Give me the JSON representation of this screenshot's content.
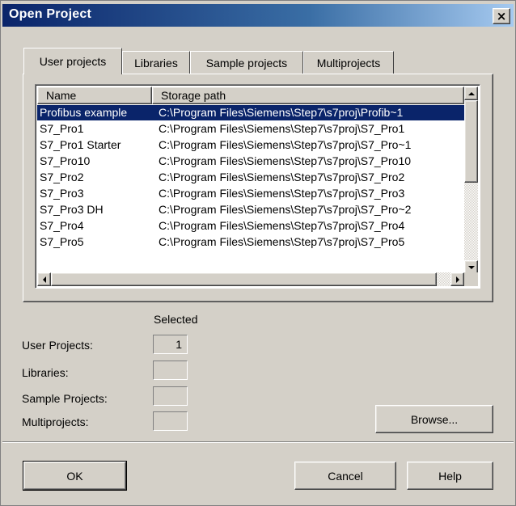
{
  "window": {
    "title": "Open Project",
    "close_glyph": "×"
  },
  "tabs": [
    {
      "label": "User projects",
      "active": true
    },
    {
      "label": "Libraries",
      "active": false
    },
    {
      "label": "Sample projects",
      "active": false
    },
    {
      "label": "Multiprojects",
      "active": false
    }
  ],
  "list": {
    "columns": [
      "Name",
      "Storage path"
    ],
    "rows": [
      {
        "name": "Profibus example",
        "path": "C:\\Program Files\\Siemens\\Step7\\s7proj\\Profib~1",
        "selected": true
      },
      {
        "name": "S7_Pro1",
        "path": "C:\\Program Files\\Siemens\\Step7\\s7proj\\S7_Pro1"
      },
      {
        "name": "S7_Pro1 Starter",
        "path": "C:\\Program Files\\Siemens\\Step7\\s7proj\\S7_Pro~1"
      },
      {
        "name": "S7_Pro10",
        "path": "C:\\Program Files\\Siemens\\Step7\\s7proj\\S7_Pro10"
      },
      {
        "name": "S7_Pro2",
        "path": "C:\\Program Files\\Siemens\\Step7\\s7proj\\S7_Pro2"
      },
      {
        "name": "S7_Pro3",
        "path": "C:\\Program Files\\Siemens\\Step7\\s7proj\\S7_Pro3"
      },
      {
        "name": "S7_Pro3 DH",
        "path": "C:\\Program Files\\Siemens\\Step7\\s7proj\\S7_Pro~2"
      },
      {
        "name": "S7_Pro4",
        "path": "C:\\Program Files\\Siemens\\Step7\\s7proj\\S7_Pro4"
      },
      {
        "name": "S7_Pro5",
        "path": "C:\\Program Files\\Siemens\\Step7\\s7proj\\S7_Pro5"
      }
    ]
  },
  "summary": {
    "header": "Selected",
    "items": [
      {
        "label": "User Projects:",
        "value": "1"
      },
      {
        "label": "Libraries:",
        "value": ""
      },
      {
        "label": "Sample Projects:",
        "value": ""
      },
      {
        "label": "Multiprojects:",
        "value": ""
      }
    ]
  },
  "buttons": {
    "browse": "Browse...",
    "ok": "OK",
    "cancel": "Cancel",
    "help": "Help"
  },
  "colors": {
    "title_bar": "#0a246a",
    "selection": "#0a246a",
    "face": "#d4d0c8"
  }
}
